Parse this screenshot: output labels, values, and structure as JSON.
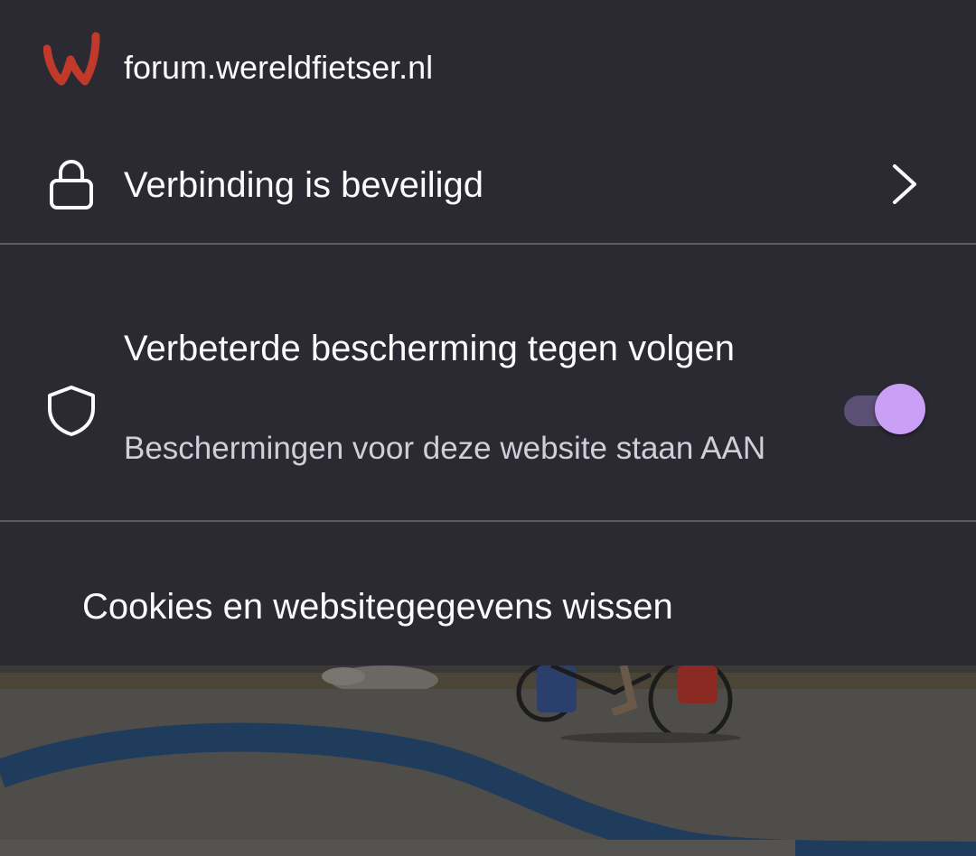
{
  "site": {
    "domain": "forum.wereldfietser.nl",
    "logo_icon": "wereldfietser-logo",
    "logo_color": "#c0392b"
  },
  "connection": {
    "label": "Verbinding is beveiligd",
    "icon": "lock-icon",
    "chevron": "chevron-right-icon"
  },
  "tracking_protection": {
    "title": "Verbeterde bescherming tegen volgen",
    "subtitle": "Beschermingen voor deze website staan AAN",
    "icon": "shield-icon",
    "enabled": true,
    "toggle_color": "#c9a0f5"
  },
  "cookies": {
    "label": "Cookies en websitegegevens wissen"
  },
  "colors": {
    "panel_background": "#2b2a33",
    "text_primary": "#fbfbfe",
    "text_secondary": "#cfcfd8",
    "divider": "#5c5b64"
  }
}
